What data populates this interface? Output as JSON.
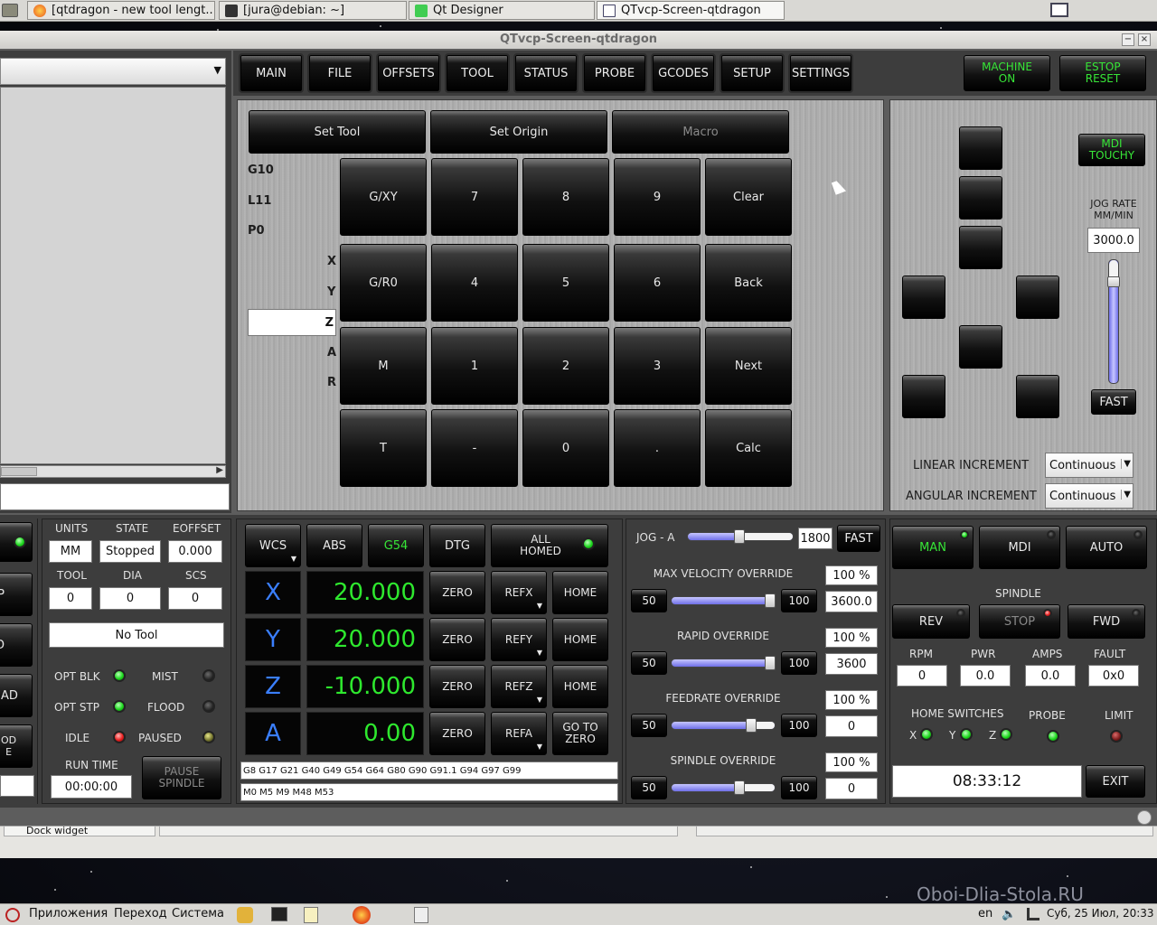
{
  "taskbar": {
    "tabs": [
      {
        "label": "[qtdragon - new tool lengt..."
      },
      {
        "label": "[jura@debian: ~]"
      },
      {
        "label": "Qt Designer"
      },
      {
        "label": "QTvcp-Screen-qtdragon"
      }
    ]
  },
  "window": {
    "title": "QTvcp-Screen-qtdragon"
  },
  "nav": {
    "tabs": [
      "MAIN",
      "FILE",
      "OFFSETS",
      "TOOL",
      "STATUS",
      "PROBE",
      "GCODES",
      "SETUP",
      "SETTINGS"
    ],
    "machine_on": "MACHINE\nON",
    "estop": "ESTOP\nRESET"
  },
  "calc": {
    "set_tool": "Set Tool",
    "set_origin": "Set Origin",
    "macro": "Macro",
    "labels_left": [
      "G10",
      "L11",
      "P0"
    ],
    "axis_letters": [
      "X",
      "Y",
      "Z",
      "A",
      "R"
    ],
    "keys": [
      [
        "G/XY",
        "7",
        "8",
        "9",
        "Clear"
      ],
      [
        "G/R0",
        "4",
        "5",
        "6",
        "Back"
      ],
      [
        "M",
        "1",
        "2",
        "3",
        "Next"
      ],
      [
        "T",
        "-",
        "0",
        ".",
        "Calc"
      ]
    ]
  },
  "jog": {
    "mdi_touchy": "MDI\nTOUCHY",
    "jog_rate_label": "JOG RATE\nMM/MIN",
    "jog_rate_value": "3000.0",
    "fast": "FAST",
    "linear_increment_label": "LINEAR INCREMENT",
    "linear_increment_value": "Continuous",
    "angular_increment_label": "ANGULAR INCREMENT",
    "angular_increment_value": "Continuous"
  },
  "status": {
    "units_label": "UNITS",
    "units_value": "MM",
    "state_label": "STATE",
    "state_value": "Stopped",
    "eoffset_label": "EOFFSET",
    "eoffset_value": "0.000",
    "tool_label": "TOOL",
    "tool_value": "0",
    "dia_label": "DIA",
    "dia_value": "0",
    "scs_label": "SCS",
    "scs_value": "0",
    "no_tool": "No Tool",
    "opt_blk": "OPT BLK",
    "mist": "MIST",
    "opt_stp": "OPT STP",
    "flood": "FLOOD",
    "idle": "IDLE",
    "paused": "PAUSED",
    "run_time_label": "RUN TIME",
    "run_time_value": "00:00:00",
    "pause_spindle": "PAUSE\nSPINDLE",
    "left_partial": [
      "P",
      "D",
      "AD",
      "OD\nE"
    ]
  },
  "dro": {
    "wcs": "WCS",
    "abs": "ABS",
    "g54": "G54",
    "dtg": "DTG",
    "all_homed": "ALL\nHOMED",
    "axes": [
      {
        "name": "X",
        "value": "20.000",
        "zero": "ZERO",
        "ref": "REFX",
        "home": "HOME"
      },
      {
        "name": "Y",
        "value": "20.000",
        "zero": "ZERO",
        "ref": "REFY",
        "home": "HOME"
      },
      {
        "name": "Z",
        "value": "-10.000",
        "zero": "ZERO",
        "ref": "REFZ",
        "home": "HOME"
      },
      {
        "name": "A",
        "value": "0.00",
        "zero": "ZERO",
        "ref": "REFA",
        "home": "GO TO\nZERO"
      }
    ],
    "gcodes": "G8 G17 G21 G40 G49 G54 G64 G80 G90 G91.1 G94 G97 G99",
    "mcodes": "M0 M5 M9 M48 M53"
  },
  "overrides": {
    "jog_a_label": "JOG - A",
    "jog_a_value": "1800",
    "jog_a_fast": "FAST",
    "items": [
      {
        "label": "MAX VELOCITY OVERRIDE",
        "percent": "100 %",
        "value": "3600.0",
        "low": "50",
        "high": "100",
        "level": 1.0
      },
      {
        "label": "RAPID OVERRIDE",
        "percent": "100 %",
        "value": "3600",
        "low": "50",
        "high": "100",
        "level": 1.0
      },
      {
        "label": "FEEDRATE OVERRIDE",
        "percent": "100 %",
        "value": "0",
        "low": "50",
        "high": "100",
        "level": 0.8
      },
      {
        "label": "SPINDLE OVERRIDE",
        "percent": "100 %",
        "value": "0",
        "low": "50",
        "high": "100",
        "level": 0.67
      }
    ],
    "jog_a_level": 0.5
  },
  "mode": {
    "man": "MAN",
    "mdi": "MDI",
    "auto": "AUTO",
    "spindle_label": "SPINDLE",
    "rev": "REV",
    "stop": "STOP",
    "fwd": "FWD",
    "rpm_label": "RPM",
    "rpm_value": "0",
    "pwr_label": "PWR",
    "pwr_value": "0.0",
    "amps_label": "AMPS",
    "amps_value": "0.0",
    "fault_label": "FAULT",
    "fault_value": "0x0",
    "home_switches_label": "HOME SWITCHES",
    "probe_label": "PROBE",
    "limit_label": "LIMIT",
    "x": "X",
    "y": "Y",
    "z": "Z",
    "clock": "08:33:12",
    "exit": "EXIT"
  },
  "dock": {
    "label": "Dock widget"
  },
  "desktop": {
    "menu_apps": "Приложения",
    "menu_go": "Переход",
    "menu_system": "Система",
    "lang": "en",
    "datetime": "Суб, 25 Июл, 20:33",
    "watermark": "Oboi-Dlia-Stola.RU"
  },
  "colors": {
    "accent_green": "#2ee82e",
    "axis_blue": "#3a7fff",
    "led_green": "#1ed81e",
    "led_red": "#e81e1e"
  }
}
